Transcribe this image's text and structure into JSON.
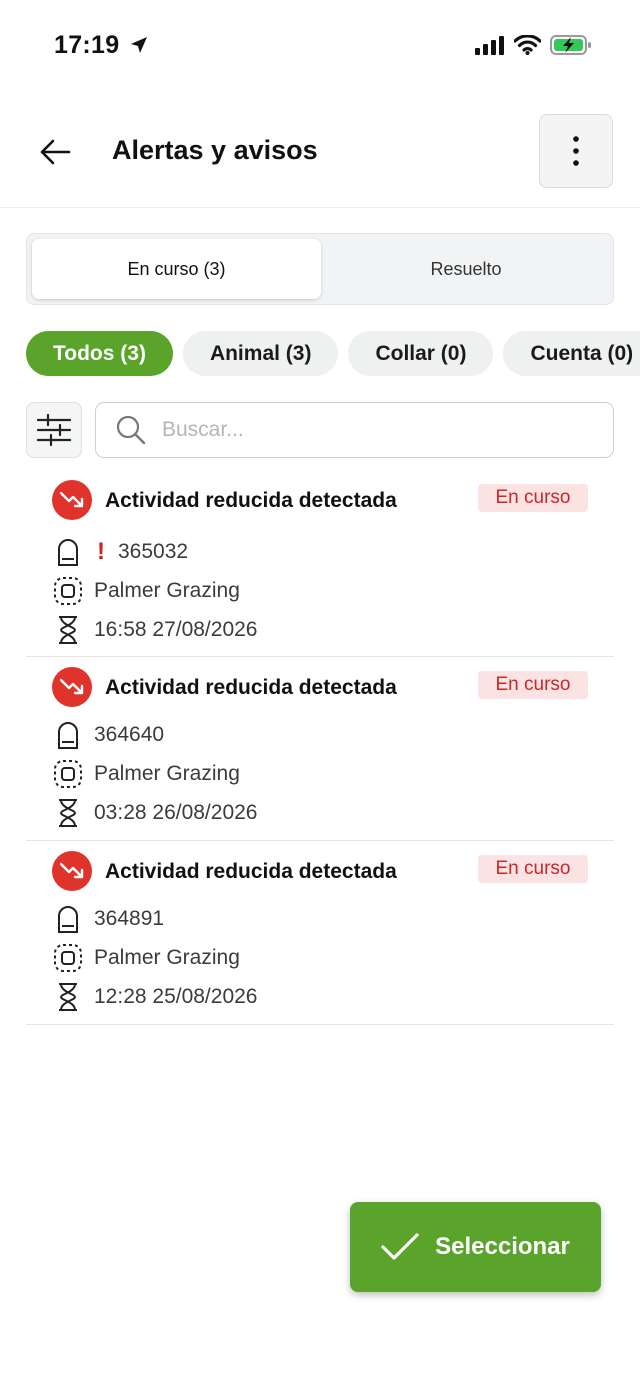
{
  "status_bar": {
    "time": "17:19"
  },
  "header": {
    "title": "Alertas y avisos"
  },
  "segments": [
    {
      "label": "En curso (3)",
      "active": true
    },
    {
      "label": "Resuelto",
      "active": false
    }
  ],
  "chips": [
    {
      "label": "Todos (3)",
      "active": true
    },
    {
      "label": "Animal (3)",
      "active": false
    },
    {
      "label": "Collar (0)",
      "active": false
    },
    {
      "label": "Cuenta (0)",
      "active": false
    }
  ],
  "search": {
    "placeholder": "Buscar..."
  },
  "alerts": [
    {
      "title": "Actividad reducida detectada",
      "status": "En curso",
      "collar_id": "365032",
      "warning": "!",
      "farm": "Palmer Grazing",
      "datetime": "16:58 27/08/2026"
    },
    {
      "title": "Actividad reducida detectada",
      "status": "En curso",
      "collar_id": "364640",
      "farm": "Palmer Grazing",
      "datetime": "03:28 26/08/2026"
    },
    {
      "title": "Actividad reducida detectada",
      "status": "En curso",
      "collar_id": "364891",
      "farm": "Palmer Grazing",
      "datetime": "12:28 25/08/2026"
    }
  ],
  "actions": {
    "select_label": "Seleccionar"
  },
  "colors": {
    "accent_green": "#5aa42b",
    "alert_red": "#e0332c",
    "badge_bg": "#fce3e3",
    "badge_text": "#cc2626"
  },
  "icons": {
    "status_bar": [
      "location-arrow-icon",
      "cellular-signal-icon",
      "wifi-icon",
      "battery-charging-icon"
    ],
    "header": [
      "back-arrow-icon",
      "more-vertical-icon"
    ],
    "toolbar": [
      "filter-sliders-icon",
      "search-icon"
    ],
    "alert": [
      "trending-down-icon",
      "collar-icon",
      "warning-icon",
      "location-icon",
      "hourglass-icon"
    ],
    "select": "checkmark-icon"
  }
}
